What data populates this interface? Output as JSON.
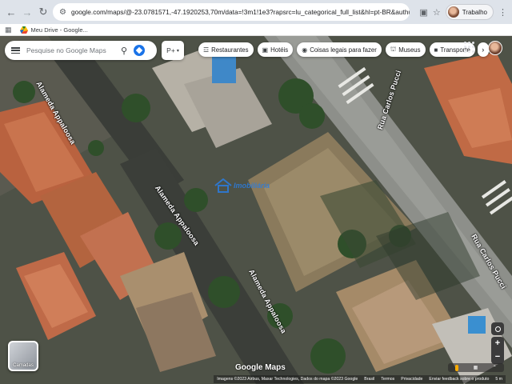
{
  "browser": {
    "url": "google.com/maps/@-23.0781571,-47.1920253,70m/data=!3m1!1e3?rapsrc=lu_categorical_full_list&hl=pt-BR&authuser=0&entry=ttu&g_ep=Eg...",
    "profile_label": "Trabalho"
  },
  "bookmarks": [
    {
      "label": "Meu Drive - Google..."
    }
  ],
  "search": {
    "placeholder": "Pesquise no Google Maps"
  },
  "pv_button": {
    "label": "P+"
  },
  "chips": [
    {
      "icon": "fork-knife-icon",
      "label": "Restaurantes"
    },
    {
      "icon": "bed-icon",
      "label": "Hotéis"
    },
    {
      "icon": "camera-icon",
      "label": "Coisas legais para fazer"
    },
    {
      "icon": "museum-icon",
      "label": "Museus"
    },
    {
      "icon": "bus-icon",
      "label": "Transporte"
    }
  ],
  "streets": {
    "s1": "Alameda Appaloosa",
    "s2": "Alameda Appaloosa",
    "s3": "Alameda Appaloosa",
    "s4": "Rua Carlos Pucci",
    "s5": "Rua Carlos Pucci"
  },
  "layers": {
    "label": "Camadas"
  },
  "logo": {
    "text": "Google Maps"
  },
  "footer": {
    "attribution": "Imagens ©2023 Airbus, Maxar Technologies, Dados do mapa ©2023 Google",
    "region": "Brasil",
    "terms": "Termos",
    "privacy": "Privacidade",
    "feedback": "Enviar feedback sobre o produto",
    "scale": "5 m"
  },
  "watermark": {
    "brand": "Imobiliária"
  },
  "colors": {
    "accent": "#1a73e8",
    "chrome": "#dee3ea",
    "pegman": "#f9ab00"
  }
}
